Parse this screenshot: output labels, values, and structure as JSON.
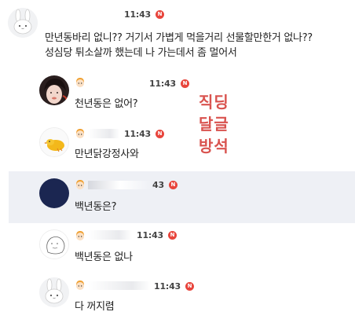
{
  "messages": [
    {
      "id": "m1",
      "time": "11:43",
      "badge": "N",
      "lines": [
        "만년동바리 없니?? 거기서 가볍게 먹을거리 선물할만한거 없나??",
        "성심당 튀소살까 했는데 나 가는데서 좀 멀어서"
      ],
      "avatar": "rabbit-avatar"
    },
    {
      "id": "m2",
      "time": "11:43",
      "badge": "N",
      "lines": [
        "천년동은 없어?"
      ],
      "avatar": "photo-avatar"
    },
    {
      "id": "m3",
      "time": "11:43",
      "badge": "N",
      "lines": [
        "만년닭강정사와"
      ],
      "avatar": "chick-avatar"
    },
    {
      "id": "m4",
      "time": "43",
      "badge": "N",
      "lines": [
        "백년동은?"
      ],
      "avatar": "navy-avatar"
    },
    {
      "id": "m5",
      "time": "11:43",
      "badge": "N",
      "lines": [
        "백년동은 없나"
      ],
      "avatar": "sketch-avatar"
    },
    {
      "id": "m6",
      "time": "11:43",
      "badge": "N",
      "lines": [
        "다 꺼지렴"
      ],
      "avatar": "rabbit-avatar"
    }
  ],
  "annotation": [
    "직딩",
    "달글",
    "방석"
  ],
  "colors": {
    "highlight_row": "#eef0f5",
    "badge": "#e8453c",
    "annotation": "#d9534f",
    "navy_avatar": "#1b2651"
  }
}
